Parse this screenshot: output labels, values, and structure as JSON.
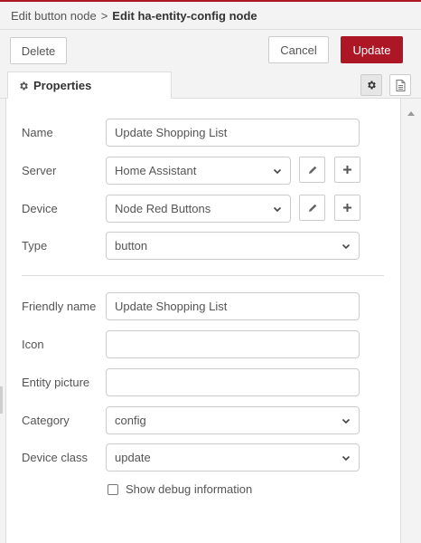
{
  "breadcrumb": {
    "parent": "Edit button node",
    "separator": ">",
    "current": "Edit ha-entity-config node"
  },
  "toolbar": {
    "delete_label": "Delete",
    "cancel_label": "Cancel",
    "update_label": "Update"
  },
  "tabs": {
    "properties_label": "Properties"
  },
  "form": {
    "name_label": "Name",
    "name_value": "Update Shopping List",
    "server_label": "Server",
    "server_value": "Home Assistant",
    "device_label": "Device",
    "device_value": "Node Red Buttons",
    "type_label": "Type",
    "type_value": "button",
    "friendly_name_label": "Friendly name",
    "friendly_name_value": "Update Shopping List",
    "icon_label": "Icon",
    "icon_value": "",
    "entity_picture_label": "Entity picture",
    "entity_picture_value": "",
    "category_label": "Category",
    "category_value": "config",
    "device_class_label": "Device class",
    "device_class_value": "update",
    "debug_label": "Show debug information",
    "debug_checked": false
  },
  "colors": {
    "accent": "#ad1625",
    "toolbar_bg": "#f3f3f3",
    "border": "#cccccc"
  },
  "icons": [
    "gear-icon",
    "document-icon",
    "pencil-icon",
    "plus-icon",
    "chevron-down-icon"
  ]
}
